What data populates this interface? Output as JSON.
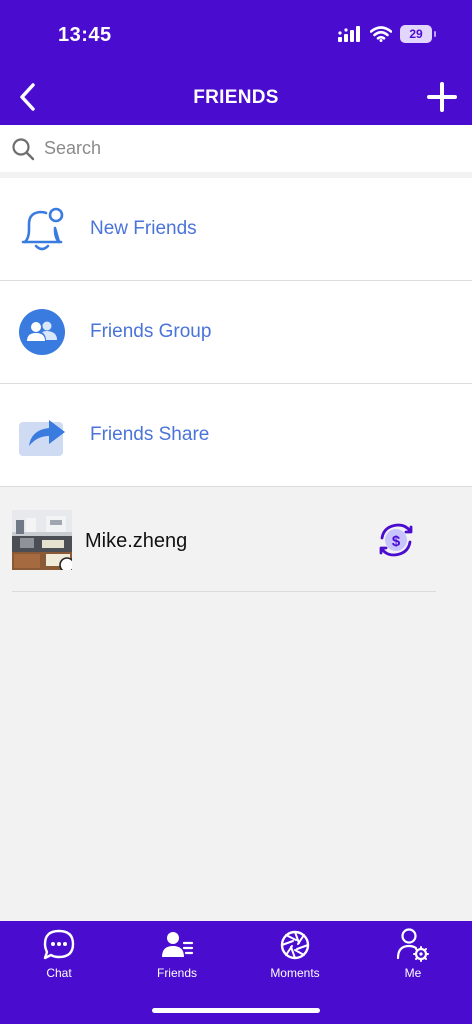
{
  "status_bar": {
    "time": "13:45",
    "battery": "29"
  },
  "nav": {
    "title": "FRIENDS"
  },
  "search": {
    "placeholder": "Search"
  },
  "menu": {
    "items": [
      {
        "label": "New Friends",
        "icon": "bell-icon"
      },
      {
        "label": "Friends Group",
        "icon": "group-icon"
      },
      {
        "label": "Friends Share",
        "icon": "share-icon"
      }
    ]
  },
  "contacts": [
    {
      "name": "Mike.zheng",
      "action_icon": "dollar-exchange-icon"
    }
  ],
  "tab_bar": {
    "tabs": [
      {
        "label": "Chat",
        "icon": "chat-bubble-icon"
      },
      {
        "label": "Friends",
        "icon": "friends-icon"
      },
      {
        "label": "Moments",
        "icon": "aperture-icon"
      },
      {
        "label": "Me",
        "icon": "user-settings-icon"
      }
    ]
  },
  "colors": {
    "brand": "#4a0ccf",
    "link": "#4a74d9",
    "background": "#f2f2f2"
  }
}
